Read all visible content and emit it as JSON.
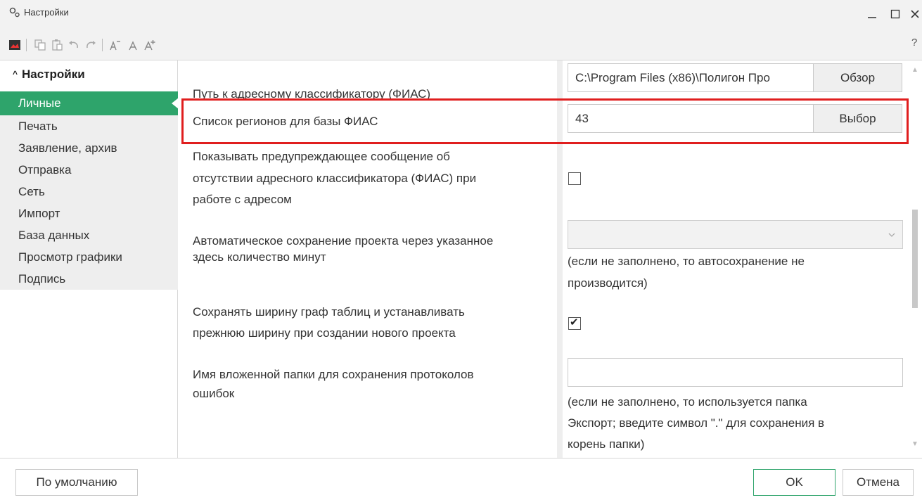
{
  "window": {
    "title": "Настройки"
  },
  "toolbar": {
    "icons": [
      "image-icon",
      "copy-icon",
      "paste-icon",
      "undo-icon",
      "redo-icon",
      "font-decrease-icon",
      "font-normal-icon",
      "font-increase-icon"
    ],
    "help": "?"
  },
  "sidebar": {
    "header": "Настройки",
    "items": [
      {
        "label": "Личные",
        "active": true
      },
      {
        "label": "Печать"
      },
      {
        "label": "Заявление, архив"
      },
      {
        "label": "Отправка"
      },
      {
        "label": "Сеть"
      },
      {
        "label": "Импорт"
      },
      {
        "label": "База данных"
      },
      {
        "label": "Просмотр графики"
      },
      {
        "label": "Подпись"
      }
    ]
  },
  "settings": {
    "fias_path": {
      "label": "Путь к адресному классификатору (ФИАС)",
      "value": "C:\\Program Files (x86)\\Полигон Про",
      "button": "Обзор"
    },
    "regions": {
      "label": "Список регионов для базы ФИАС",
      "value": "43",
      "button": "Выбор"
    },
    "warning": {
      "label_line1": "Показывать предупреждающее сообщение об",
      "label_line2": "отсутствии адресного классификатора (ФИАС) при",
      "label_line3": "работе с адресом",
      "checked": false
    },
    "autosave": {
      "label_line1": "Автоматическое сохранение проекта через указанное",
      "label_line2": "здесь количество минут",
      "value": "",
      "note_line1": "(если не заполнено, то автосохранение не",
      "note_line2": "производится)"
    },
    "column_width": {
      "label_line1": "Сохранять ширину граф таблиц и устанавливать",
      "label_line2": "прежнюю ширину при создании нового проекта",
      "checked": true
    },
    "error_folder": {
      "label_line1": "Имя вложенной папки для сохранения протоколов",
      "label_line2": "ошибок",
      "value": "",
      "note_line1": "(если не заполнено, то используется папка",
      "note_line2": "Экспорт; введите символ \".\" для сохранения в",
      "note_line3": "корень папки)"
    }
  },
  "footer": {
    "defaults_button": "По умолчанию",
    "ok_button": "OK",
    "cancel_button": "Отмена"
  },
  "colors": {
    "accent": "#2ea46b",
    "highlight": "#e01e1e"
  }
}
